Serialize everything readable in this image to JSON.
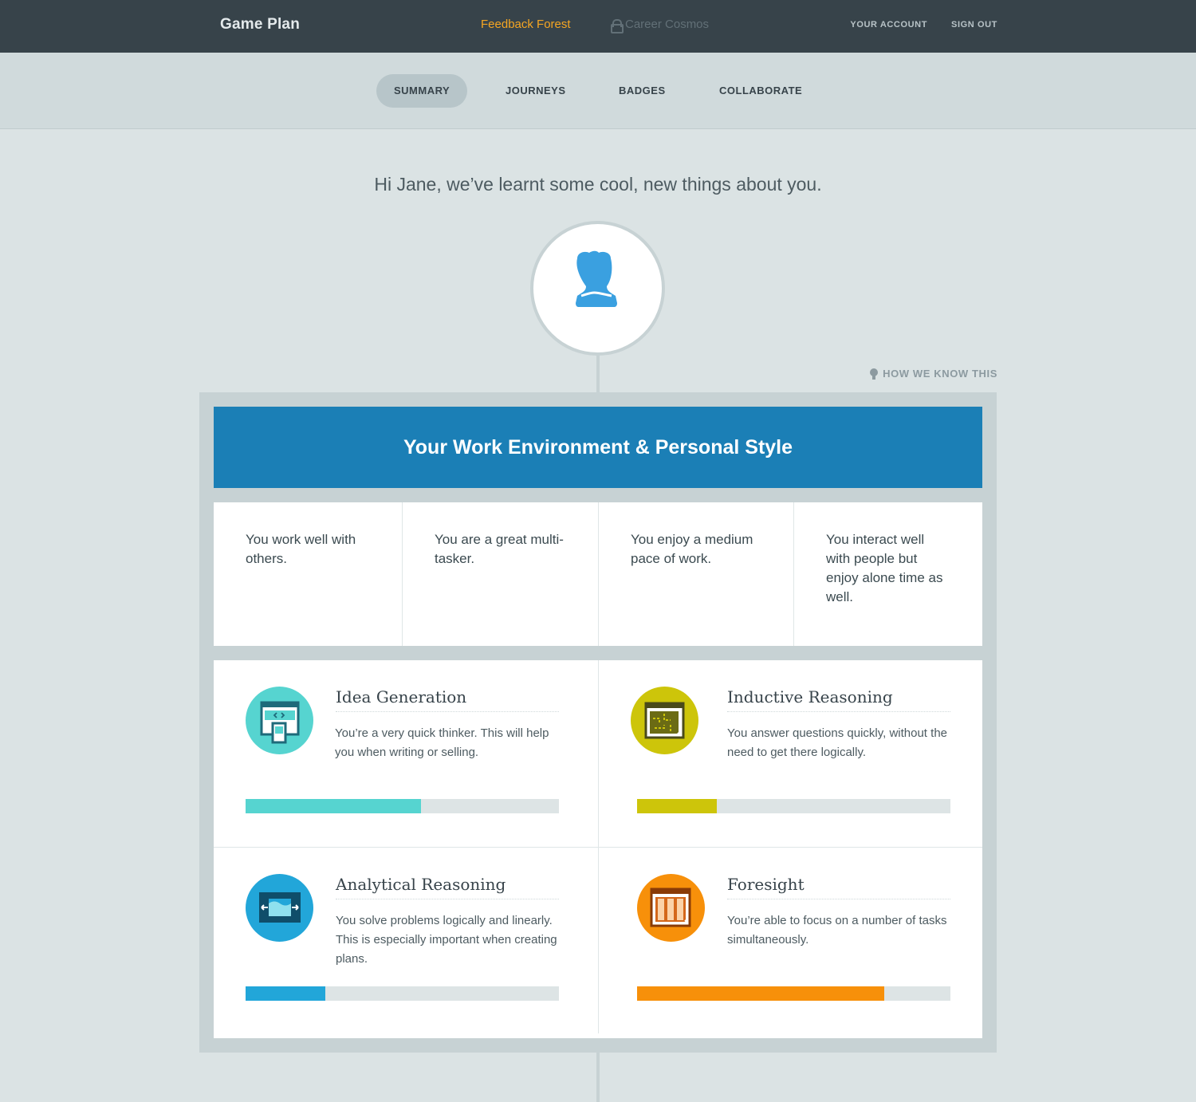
{
  "header": {
    "brand": "Game Plan",
    "active_link": "Feedback Forest",
    "locked_link": "Career Cosmos",
    "account": "YOUR ACCOUNT",
    "signout": "SIGN OUT",
    "active_color": "#f5a623"
  },
  "tabs": [
    {
      "label": "SUMMARY",
      "selected": true
    },
    {
      "label": "JOURNEYS",
      "selected": false
    },
    {
      "label": "BADGES",
      "selected": false
    },
    {
      "label": "COLLABORATE",
      "selected": false
    }
  ],
  "greeting": "Hi Jane, we’ve learnt some cool, new things about you.",
  "avatar_icon": "head-profile-icon",
  "how_link": "HOW WE KNOW THIS",
  "section_title": "Your Work Environment & Personal Style",
  "traits": [
    "You work well with others.",
    "You are a great multi-tasker.",
    "You enjoy a medium pace of work.",
    "You interact well with people but enjoy alone time as well."
  ],
  "skills": [
    {
      "title": "Idea Generation",
      "desc": "You’re a very quick thinker. This will help you when writing or selling.",
      "color": "#56d4d0",
      "level": 0.56,
      "icon": "browser-devices-icon"
    },
    {
      "title": "Inductive Reasoning",
      "desc": "You answer questions quickly, without the need to get there logically.",
      "color": "#cdc50a",
      "level": 0.255,
      "icon": "puzzle-window-icon"
    },
    {
      "title": "Analytical Reasoning",
      "desc": "You solve problems logically and linearly. This is especially important when creating plans.",
      "color": "#22a6d9",
      "level": 0.255,
      "icon": "wave-window-icon"
    },
    {
      "title": "Foresight",
      "desc": "You’re able to focus on a number of tasks simultaneously.",
      "color": "#f7900a",
      "level": 0.79,
      "icon": "columns-window-icon"
    }
  ]
}
